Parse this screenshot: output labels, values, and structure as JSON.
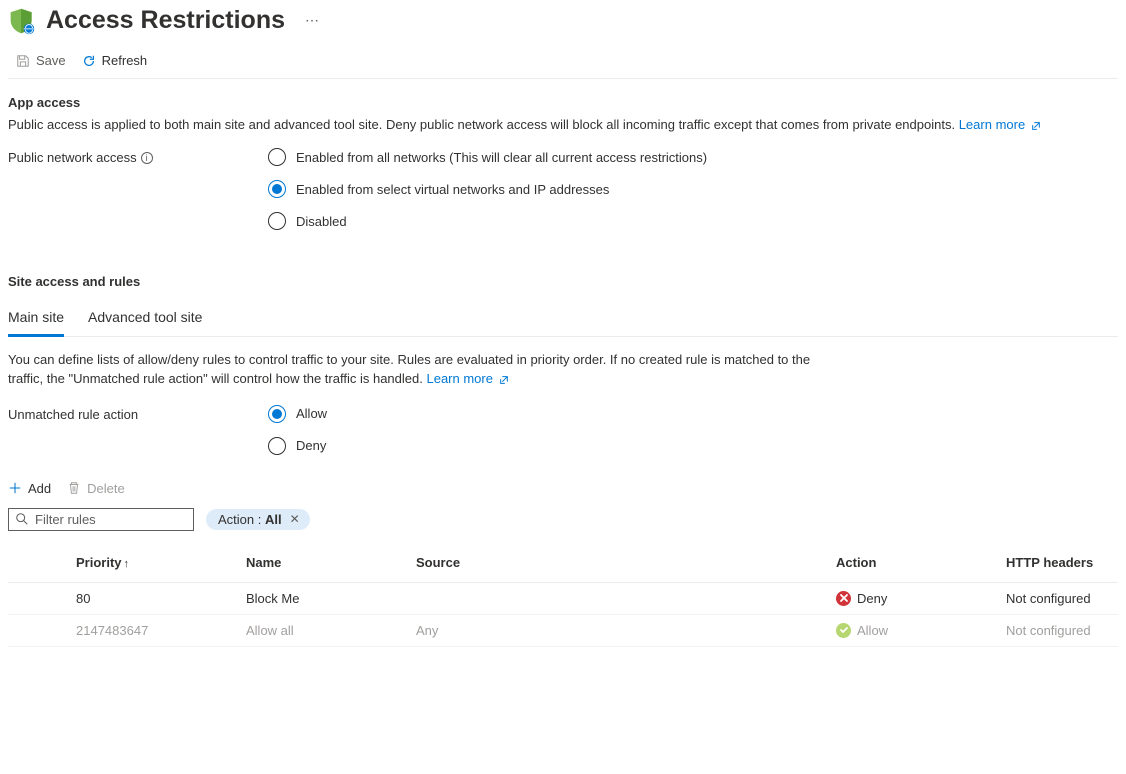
{
  "header": {
    "title": "Access Restrictions"
  },
  "commands": {
    "save": "Save",
    "refresh": "Refresh"
  },
  "app_access": {
    "title": "App access",
    "desc": "Public access is applied to both main site and advanced tool site. Deny public network access will block all incoming traffic except that comes from private endpoints.",
    "learn_more": "Learn more",
    "public_network_label": "Public network access",
    "options": {
      "all": "Enabled from all networks (This will clear all current access restrictions)",
      "select": "Enabled from select virtual networks and IP addresses",
      "disabled": "Disabled"
    }
  },
  "site_rules": {
    "title": "Site access and rules",
    "tabs": {
      "main": "Main site",
      "advanced": "Advanced tool site"
    },
    "desc": "You can define lists of allow/deny rules to control traffic to your site. Rules are evaluated in priority order. If no created rule is matched to the traffic, the \"Unmatched rule action\" will control how the traffic is handled.",
    "learn_more": "Learn more",
    "unmatched_label": "Unmatched rule action",
    "unmatched_options": {
      "allow": "Allow",
      "deny": "Deny"
    }
  },
  "rules_toolbar": {
    "add": "Add",
    "delete": "Delete",
    "filter_placeholder": "Filter rules",
    "pill_key": "Action : ",
    "pill_val": "All"
  },
  "table": {
    "columns": {
      "priority": "Priority",
      "name": "Name",
      "source": "Source",
      "action": "Action",
      "http_headers": "HTTP headers"
    },
    "rows": [
      {
        "priority": "80",
        "name": "Block Me",
        "source": "",
        "action": "Deny",
        "http_headers": "Not configured",
        "dim": false
      },
      {
        "priority": "2147483647",
        "name": "Allow all",
        "source": "Any",
        "action": "Allow",
        "http_headers": "Not configured",
        "dim": true
      }
    ]
  }
}
